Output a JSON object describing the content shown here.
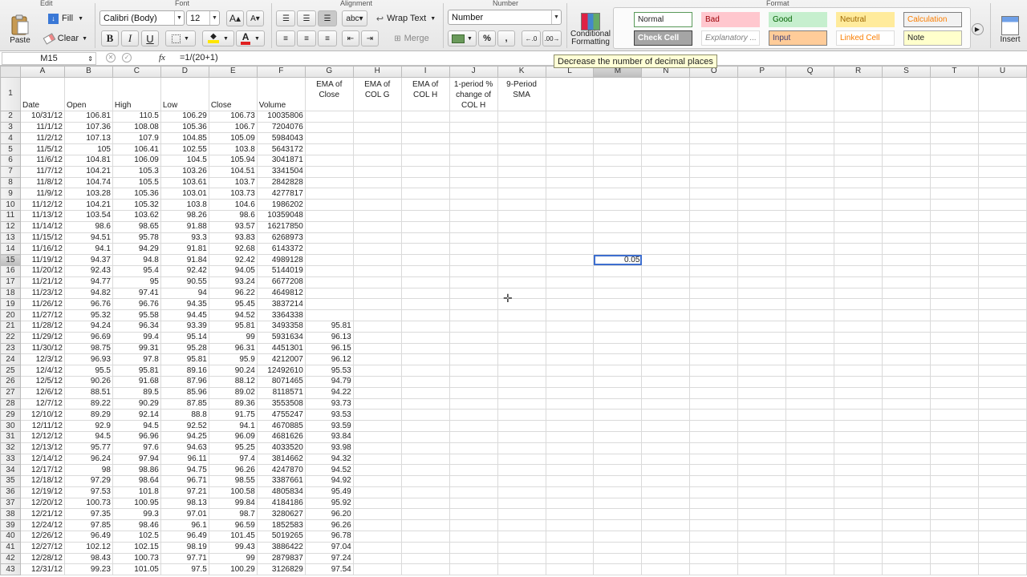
{
  "ribbon": {
    "groups": {
      "edit": "Edit",
      "font": "Font",
      "alignment": "Alignment",
      "number": "Number",
      "format": "Format"
    },
    "paste_label": "Paste",
    "fill_label": "Fill",
    "clear_label": "Clear",
    "font_name": "Calibri (Body)",
    "font_size": "12",
    "bold": "B",
    "italic": "I",
    "underline": "U",
    "wrap_text_label": "Wrap Text",
    "merge_label": "Merge",
    "number_format": "Number",
    "percent": "%",
    "comma": ",",
    "conditional_formatting_line1": "Conditional",
    "conditional_formatting_line2": "Formatting",
    "insert_label": "Insert",
    "cell_styles": [
      {
        "label": "Normal",
        "bg": "#ffffff",
        "fg": "#222222",
        "border": "#5a9a5a"
      },
      {
        "label": "Bad",
        "bg": "#ffc7ce",
        "fg": "#9c0006",
        "border": "#ffc7ce"
      },
      {
        "label": "Good",
        "bg": "#c6efce",
        "fg": "#006100",
        "border": "#c6efce"
      },
      {
        "label": "Neutral",
        "bg": "#ffeb9c",
        "fg": "#9c6500",
        "border": "#ffeb9c"
      },
      {
        "label": "Calculation",
        "bg": "#f2f2f2",
        "fg": "#fa7d00",
        "border": "#7f7f7f"
      },
      {
        "label": "Check Cell",
        "bg": "#a5a5a5",
        "fg": "#ffffff",
        "border": "#3f3f3f"
      },
      {
        "label": "Explanatory ...",
        "bg": "#ffffff",
        "fg": "#7f7f7f",
        "border": "#dddddd"
      },
      {
        "label": "Input",
        "bg": "#ffcc99",
        "fg": "#3f3f76",
        "border": "#7f7f7f"
      },
      {
        "label": "Linked Cell",
        "bg": "#ffffff",
        "fg": "#fa7d00",
        "border": "#dddddd"
      },
      {
        "label": "Note",
        "bg": "#ffffcc",
        "fg": "#222222",
        "border": "#b2b2b2"
      }
    ]
  },
  "formula_bar": {
    "name_box": "M15",
    "fx": "fx",
    "formula": "=1/(20+1)"
  },
  "tooltip": "Decrease the number of decimal places",
  "grid": {
    "columns": [
      "A",
      "B",
      "C",
      "D",
      "E",
      "F",
      "G",
      "H",
      "I",
      "J",
      "K",
      "L",
      "M",
      "N",
      "O",
      "P",
      "Q",
      "R",
      "S",
      "T",
      "U"
    ],
    "headers": [
      "Date",
      "Open",
      "High",
      "Low",
      "Close",
      "Volume",
      "EMA of Close",
      "EMA of COL G",
      "EMA of COL H",
      "1-period % change of COL H",
      "9-Period SMA"
    ],
    "selected_cell": {
      "col": "M",
      "row": 15,
      "value": "0.05"
    },
    "rows": [
      [
        "10/31/12",
        "106.81",
        "110.5",
        "106.29",
        "106.73",
        "10035806",
        ""
      ],
      [
        "11/1/12",
        "107.36",
        "108.08",
        "105.36",
        "106.7",
        "7204076",
        ""
      ],
      [
        "11/2/12",
        "107.13",
        "107.9",
        "104.85",
        "105.09",
        "5984043",
        ""
      ],
      [
        "11/5/12",
        "105",
        "106.41",
        "102.55",
        "103.8",
        "5643172",
        ""
      ],
      [
        "11/6/12",
        "104.81",
        "106.09",
        "104.5",
        "105.94",
        "3041871",
        ""
      ],
      [
        "11/7/12",
        "104.21",
        "105.3",
        "103.26",
        "104.51",
        "3341504",
        ""
      ],
      [
        "11/8/12",
        "104.74",
        "105.5",
        "103.61",
        "103.7",
        "2842828",
        ""
      ],
      [
        "11/9/12",
        "103.28",
        "105.36",
        "103.01",
        "103.73",
        "4277817",
        ""
      ],
      [
        "11/12/12",
        "104.21",
        "105.32",
        "103.8",
        "104.6",
        "1986202",
        ""
      ],
      [
        "11/13/12",
        "103.54",
        "103.62",
        "98.26",
        "98.6",
        "10359048",
        ""
      ],
      [
        "11/14/12",
        "98.6",
        "98.65",
        "91.88",
        "93.57",
        "16217850",
        ""
      ],
      [
        "11/15/12",
        "94.51",
        "95.78",
        "93.3",
        "93.83",
        "6268973",
        ""
      ],
      [
        "11/16/12",
        "94.1",
        "94.29",
        "91.81",
        "92.68",
        "6143372",
        ""
      ],
      [
        "11/19/12",
        "94.37",
        "94.8",
        "91.84",
        "92.42",
        "4989128",
        ""
      ],
      [
        "11/20/12",
        "92.43",
        "95.4",
        "92.42",
        "94.05",
        "5144019",
        ""
      ],
      [
        "11/21/12",
        "94.77",
        "95",
        "90.55",
        "93.24",
        "6677208",
        ""
      ],
      [
        "11/23/12",
        "94.82",
        "97.41",
        "94",
        "96.22",
        "4649812",
        ""
      ],
      [
        "11/26/12",
        "96.76",
        "96.76",
        "94.35",
        "95.45",
        "3837214",
        ""
      ],
      [
        "11/27/12",
        "95.32",
        "95.58",
        "94.45",
        "94.52",
        "3364338",
        ""
      ],
      [
        "11/28/12",
        "94.24",
        "96.34",
        "93.39",
        "95.81",
        "3493358",
        "95.81"
      ],
      [
        "11/29/12",
        "96.69",
        "99.4",
        "95.14",
        "99",
        "5931634",
        "96.13"
      ],
      [
        "11/30/12",
        "98.75",
        "99.31",
        "95.28",
        "96.31",
        "4451301",
        "96.15"
      ],
      [
        "12/3/12",
        "96.93",
        "97.8",
        "95.81",
        "95.9",
        "4212007",
        "96.12"
      ],
      [
        "12/4/12",
        "95.5",
        "95.81",
        "89.16",
        "90.24",
        "12492610",
        "95.53"
      ],
      [
        "12/5/12",
        "90.26",
        "91.68",
        "87.96",
        "88.12",
        "8071465",
        "94.79"
      ],
      [
        "12/6/12",
        "88.51",
        "89.5",
        "85.96",
        "89.02",
        "8118571",
        "94.22"
      ],
      [
        "12/7/12",
        "89.22",
        "90.29",
        "87.85",
        "89.36",
        "3553508",
        "93.73"
      ],
      [
        "12/10/12",
        "89.29",
        "92.14",
        "88.8",
        "91.75",
        "4755247",
        "93.53"
      ],
      [
        "12/11/12",
        "92.9",
        "94.5",
        "92.52",
        "94.1",
        "4670885",
        "93.59"
      ],
      [
        "12/12/12",
        "94.5",
        "96.96",
        "94.25",
        "96.09",
        "4681626",
        "93.84"
      ],
      [
        "12/13/12",
        "95.77",
        "97.6",
        "94.63",
        "95.25",
        "4033520",
        "93.98"
      ],
      [
        "12/14/12",
        "96.24",
        "97.94",
        "96.11",
        "97.4",
        "3814662",
        "94.32"
      ],
      [
        "12/17/12",
        "98",
        "98.86",
        "94.75",
        "96.26",
        "4247870",
        "94.52"
      ],
      [
        "12/18/12",
        "97.29",
        "98.64",
        "96.71",
        "98.55",
        "3387661",
        "94.92"
      ],
      [
        "12/19/12",
        "97.53",
        "101.8",
        "97.21",
        "100.58",
        "4805834",
        "95.49"
      ],
      [
        "12/20/12",
        "100.73",
        "100.95",
        "98.13",
        "99.84",
        "4184186",
        "95.92"
      ],
      [
        "12/21/12",
        "97.35",
        "99.3",
        "97.01",
        "98.7",
        "3280627",
        "96.20"
      ],
      [
        "12/24/12",
        "97.85",
        "98.46",
        "96.1",
        "96.59",
        "1852583",
        "96.26"
      ],
      [
        "12/26/12",
        "96.49",
        "102.5",
        "96.49",
        "101.45",
        "5019265",
        "96.78"
      ],
      [
        "12/27/12",
        "102.12",
        "102.15",
        "98.19",
        "99.43",
        "3886422",
        "97.04"
      ],
      [
        "12/28/12",
        "98.43",
        "100.73",
        "97.71",
        "99",
        "2879837",
        "97.24"
      ],
      [
        "12/31/12",
        "99.23",
        "101.05",
        "97.5",
        "100.29",
        "3126829",
        "97.54"
      ]
    ]
  }
}
